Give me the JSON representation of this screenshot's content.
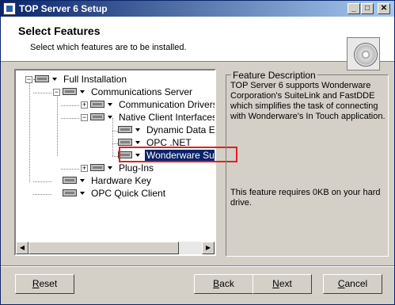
{
  "window": {
    "title": "TOP Server 6 Setup"
  },
  "titlebar_buttons": {
    "minimize": "_",
    "maximize": "□",
    "close": "✕"
  },
  "header": {
    "title": "Select Features",
    "subtitle": "Select which features are to be installed."
  },
  "tree": {
    "items": [
      {
        "label": "Full Installation",
        "expander": "−"
      },
      {
        "label": "Communications Server",
        "expander": "−"
      },
      {
        "label": "Communication Drivers",
        "expander": "+"
      },
      {
        "label": "Native Client Interfaces",
        "expander": "−"
      },
      {
        "label": "Dynamic Data E",
        "expander": ""
      },
      {
        "label": "OPC .NET",
        "expander": ""
      },
      {
        "label": "Wonderware Su",
        "expander": ""
      },
      {
        "label": "Plug-Ins",
        "expander": "+"
      },
      {
        "label": "Hardware Key",
        "expander": ""
      },
      {
        "label": "OPC Quick Client",
        "expander": ""
      }
    ],
    "selected_index": 6
  },
  "scrollbar": {
    "left_arrow": "◀",
    "right_arrow": "▶"
  },
  "description": {
    "legend": "Feature Description",
    "text": "TOP Server 6 supports Wonderware Corporation's SuiteLink and FastDDE which simplifies the task of connecting with Wonderware's In Touch application.",
    "requirement": "This feature requires 0KB on your hard drive."
  },
  "buttons": {
    "reset": "Reset",
    "back": "Back",
    "next": "Next",
    "cancel": "Cancel"
  },
  "colors": {
    "highlight_box": "#e02020",
    "selection": "#0a246a",
    "titlebar": "#0a246a"
  }
}
